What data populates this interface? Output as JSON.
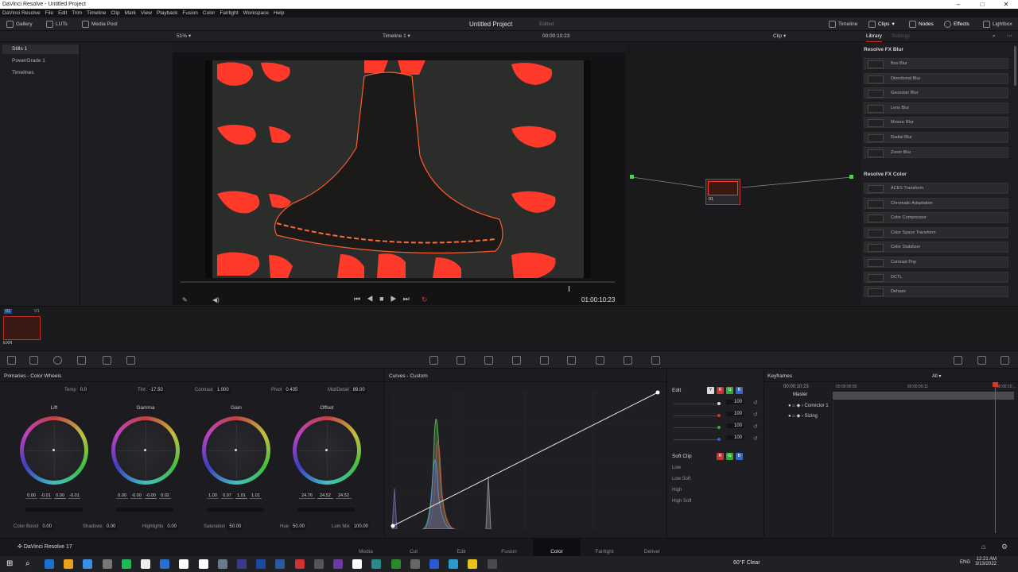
{
  "window": {
    "title": "DaVinci Resolve - Untitled Project"
  },
  "menu": [
    "DaVinci Resolve",
    "File",
    "Edit",
    "Trim",
    "Timeline",
    "Clip",
    "Mark",
    "View",
    "Playback",
    "Fusion",
    "Color",
    "Fairlight",
    "Workspace",
    "Help"
  ],
  "topbar": {
    "gallery": "Gallery",
    "luts": "LUTs",
    "media_pool": "Media Pool",
    "project": "Untitled Project",
    "edited": "Edited",
    "timeline": "Timeline",
    "clips": "Clips",
    "nodes": "Nodes",
    "effects": "Effects",
    "lightbox": "Lightbox"
  },
  "viewerbar": {
    "zoom": "51%",
    "timeline_name": "Timeline 1",
    "timecode": "00:00:10:23",
    "clip_mode": "Clip"
  },
  "gallery_panel": {
    "items": [
      "Stills 1",
      "PowerGrade 1",
      "Timelines"
    ]
  },
  "transport": {
    "timecode": "01:00:10:23"
  },
  "node": {
    "label": "01"
  },
  "library": {
    "tab_library": "Library",
    "tab_settings": "Settings",
    "blur_title": "Resolve FX Blur",
    "blur": [
      "Box Blur",
      "Directional Blur",
      "Gaussian Blur",
      "Lens Blur",
      "Mosaic Blur",
      "Radial Blur",
      "Zoom Blur"
    ],
    "color_title": "Resolve FX Color",
    "color": [
      "ACES Transform",
      "Chromatic Adaptation",
      "Color Compressor",
      "Color Space Transform",
      "Color Stabilizer",
      "Contrast Pop",
      "DCTL",
      "Dehaze"
    ]
  },
  "clip": {
    "number": "01",
    "track": "V1",
    "codec": "EXR"
  },
  "primaries": {
    "title": "Primaries - Color Wheels",
    "temp_label": "Temp",
    "temp": "0.0",
    "tint_label": "Tint",
    "tint": "-17.50",
    "contrast_label": "Contrast",
    "contrast": "1.000",
    "pivot_label": "Pivot",
    "pivot": "0.435",
    "middetail_label": "Mid/Detail",
    "middetail": "89.00",
    "wheels": [
      {
        "name": "Lift",
        "vals": [
          "0.00",
          "-0.01",
          "0.00",
          "-0.01"
        ]
      },
      {
        "name": "Gamma",
        "vals": [
          "0.00",
          "-0.00",
          "-0.00",
          "0.02"
        ]
      },
      {
        "name": "Gain",
        "vals": [
          "1.00",
          "0.97",
          "1.01",
          "1.01"
        ]
      },
      {
        "name": "Offset",
        "vals": [
          "24.76",
          "24.52",
          "24.52"
        ]
      }
    ],
    "colorboost_label": "Color Boost",
    "colorboost": "0.00",
    "shadows_label": "Shadows",
    "shadows": "0.00",
    "highlights_label": "Highlights",
    "highlights": "0.00",
    "saturation_label": "Saturation",
    "saturation": "50.00",
    "hue_label": "Hue",
    "hue": "50.00",
    "lummix_label": "Lum Mix",
    "lummix": "100.00"
  },
  "curves": {
    "title": "Curves - Custom"
  },
  "edit": {
    "title": "Edit",
    "values": [
      "100",
      "100",
      "100",
      "100"
    ],
    "y": "Y",
    "r": "R",
    "g": "G",
    "b": "B",
    "softclip": "Soft Clip",
    "low": "Low",
    "lowsoft": "Low Soft",
    "high": "High",
    "highsoft": "High Soft"
  },
  "keyframes": {
    "title": "Keyframes",
    "filter": "All",
    "timecode": "00:00:10:23",
    "t1": "00:00:00:00",
    "t2": "00:00:05:11",
    "t3": "00:00:10:...",
    "rows": [
      "Master",
      "Corrector 1",
      "Sizing"
    ]
  },
  "app": {
    "name": "DaVinci Resolve 17"
  },
  "pages": [
    "Media",
    "Cut",
    "Edit",
    "Fusion",
    "Color",
    "Fairlight",
    "Deliver"
  ],
  "taskbar": {
    "weather": "60°F Clear",
    "lang": "ENG",
    "time": "12:21 AM",
    "date": "3/13/2022"
  },
  "colors": {
    "accent_red": "#c0302a",
    "highlight": "#ff3a2a"
  }
}
